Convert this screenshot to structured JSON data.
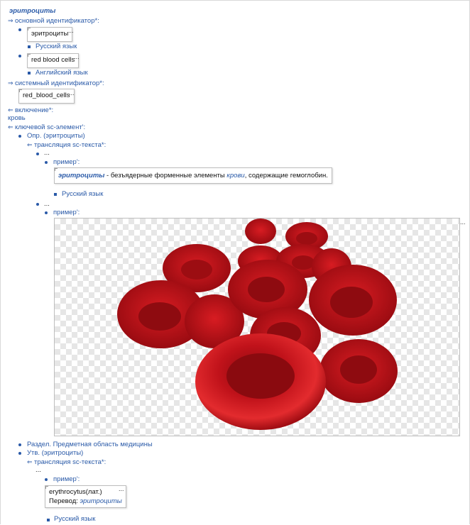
{
  "title": "эритроциты",
  "main_id_label": "основной идентификатор*:",
  "main_ids": [
    {
      "value": "эритроциты",
      "lang": "Русский язык"
    },
    {
      "value": "red blood cells",
      "lang": "Английский язык"
    }
  ],
  "sys_id_label": "системный идентификатор*:",
  "sys_id_value": "red_blood_cells",
  "inclusion_label": "включение*:",
  "inclusion_value": "кровь",
  "key_element_label": "ключевой sc-элемент':",
  "def_label": "Опр. (эритроциты)",
  "translation_label": "трансляция sc-текста*:",
  "ellipsis": "...",
  "example_label": "пример':",
  "def_text": {
    "term": "эритроциты",
    "part1": " - безъядерные форменные элементы ",
    "link": "крови",
    "part2": ", содержащие гемоглобин."
  },
  "def_lang": "Русский язык",
  "section_label": "Раздел. Предметная область медицины",
  "stmt_label": "Утв. (эритроциты)",
  "stmt_text": {
    "line1": "erythrocytus(лат.)",
    "line2_prefix": "Перевод: ",
    "line2_link": "эритроциты"
  },
  "stmt_lang": "Русский язык",
  "colors": {
    "link": "#2a5aa8",
    "cell": "#d4141b"
  },
  "image_subject": "red blood cells illustration"
}
